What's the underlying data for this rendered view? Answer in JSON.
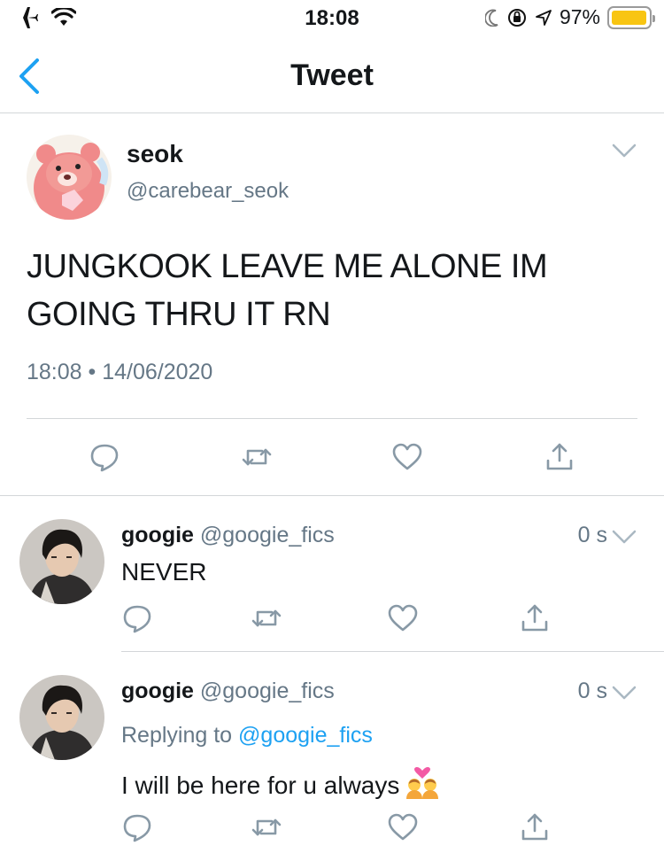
{
  "status_bar": {
    "time": "18:08",
    "battery_percent": "97%",
    "battery_level": 0.97,
    "icons": [
      "airplane-icon",
      "wifi-icon",
      "moon-icon",
      "orientation-lock-icon",
      "location-icon",
      "battery-icon"
    ]
  },
  "nav": {
    "title": "Tweet",
    "back_icon": "chevron-left-icon"
  },
  "main_tweet": {
    "display_name": "seok",
    "handle": "@carebear_seok",
    "text": "JUNGKOOK LEAVE ME ALONE IM GOING THRU IT RN",
    "timestamp": "18:08 • 14/06/2020",
    "actions": [
      "reply-icon",
      "retweet-icon",
      "like-icon",
      "share-icon"
    ]
  },
  "replies": [
    {
      "display_name": "googie",
      "handle": "@googie_fics",
      "time": "0 s",
      "text": "NEVER"
    },
    {
      "display_name": "googie",
      "handle": "@googie_fics",
      "time": "0 s",
      "replying_label": "Replying to",
      "replying_to": "@googie_fics",
      "text": "I will be here for u always",
      "emoji": "couple-with-heart-emoji"
    }
  ],
  "colors": {
    "link": "#1da1f2",
    "muted": "#657786",
    "icon_gray": "#8899a6",
    "back_blue": "#1da1f2",
    "battery": "#f8c512"
  }
}
